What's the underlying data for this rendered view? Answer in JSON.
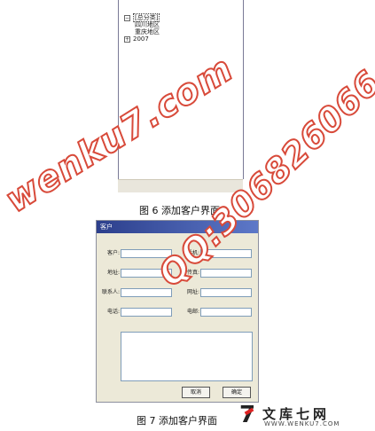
{
  "figure6": {
    "tree": {
      "root_label": "[总分类]",
      "root_toggle": "−",
      "children": [
        "四川地区",
        "重庆地区"
      ],
      "sibling_label": "2007",
      "sibling_toggle": "+"
    },
    "caption": "图 6 添加客户界面"
  },
  "figure7": {
    "dialog": {
      "title": "客户",
      "fields": {
        "customer": {
          "label": "客户:",
          "value": ""
        },
        "mobile": {
          "label": "手机:",
          "value": ""
        },
        "address": {
          "label": "地址:",
          "value": ""
        },
        "fax": {
          "label": "传真:",
          "value": ""
        },
        "contact": {
          "label": "联系人:",
          "value": ""
        },
        "website": {
          "label": "网址:",
          "value": ""
        },
        "phone": {
          "label": "电话:",
          "value": ""
        },
        "email": {
          "label": "电邮:",
          "value": ""
        }
      },
      "notes": "",
      "cancel_label": "取消",
      "ok_label": "确定"
    },
    "caption": "图 7 添加客户界面"
  },
  "watermark": {
    "left_text": "wenku7.com",
    "right_text": "QQ:306826066",
    "color": "#d84a3a"
  },
  "site_logo": {
    "mark": "7",
    "name": "文库七网",
    "url": "WWW.WENKU7.COM"
  }
}
